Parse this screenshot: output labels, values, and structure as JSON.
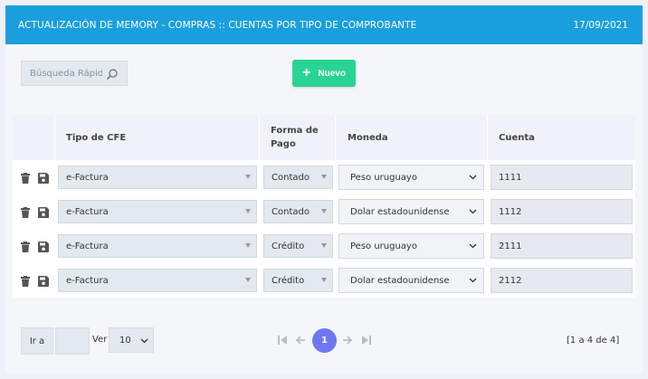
{
  "header": {
    "title": "ACTUALIZACIÓN DE MEMORY - COMPRAS :: CUENTAS POR TIPO DE COMPROBANTE",
    "date": "17/09/2021"
  },
  "toolbar": {
    "search_placeholder": "Búsqueda Rápida",
    "new_button_label": "Nuevo"
  },
  "table": {
    "columns": {
      "tipo_cfe": "Tipo de CFE",
      "forma_pago_line1": "Forma de",
      "forma_pago_line2": "Pago",
      "moneda": "Moneda",
      "cuenta": "Cuenta"
    },
    "rows": [
      {
        "tipo_cfe": "e-Factura",
        "forma_pago": "Contado",
        "moneda": "Peso uruguayo",
        "cuenta": "1111"
      },
      {
        "tipo_cfe": "e-Factura",
        "forma_pago": "Contado",
        "moneda": "Dolar estadounidense",
        "cuenta": "1112"
      },
      {
        "tipo_cfe": "e-Factura",
        "forma_pago": "Crédito",
        "moneda": "Peso uruguayo",
        "cuenta": "2111"
      },
      {
        "tipo_cfe": "e-Factura",
        "forma_pago": "Crédito",
        "moneda": "Dolar estadounidense",
        "cuenta": "2112"
      }
    ]
  },
  "pager": {
    "goto_label": "Ir a",
    "goto_value": "",
    "page_size_label": "Ver",
    "page_size": "10",
    "current_page": "1",
    "summary": "[1 a 4 de 4]"
  },
  "colors": {
    "header_bg": "#1a9fde",
    "new_button": "#28d494",
    "current_page": "#6f76f2"
  },
  "icons": [
    "search-icon",
    "plus-icon",
    "trash-icon",
    "save-icon",
    "caret-down-icon",
    "chevron-down-icon",
    "first-page-icon",
    "prev-page-icon",
    "next-page-icon",
    "last-page-icon"
  ]
}
